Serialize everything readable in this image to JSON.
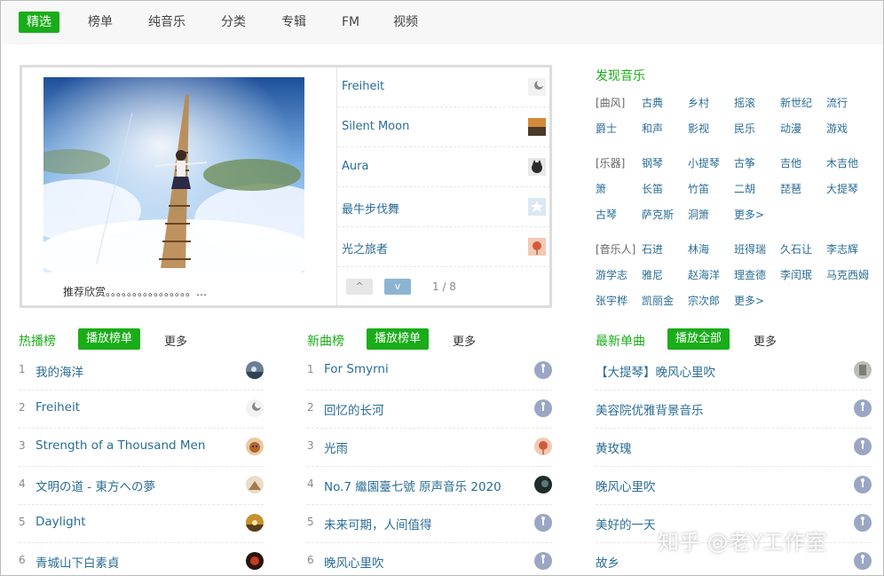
{
  "nav": {
    "tabs": [
      {
        "label": "精选",
        "active": true
      },
      {
        "label": "榜单"
      },
      {
        "label": "纯音乐"
      },
      {
        "label": "分类"
      },
      {
        "label": "专辑"
      },
      {
        "label": "FM"
      },
      {
        "label": "视频"
      }
    ]
  },
  "featured": {
    "caption": "推荐欣赏。。。。。。。。。。。。。。。。…",
    "items": [
      {
        "title": "Freiheit",
        "icon": "moon-thumb"
      },
      {
        "title": "Silent Moon",
        "icon": "sunset-thumb"
      },
      {
        "title": "Aura",
        "icon": "cat-thumb"
      },
      {
        "title": "最牛步伐舞",
        "icon": "star-thumb"
      },
      {
        "title": "光之旅者",
        "icon": "balloon-thumb"
      }
    ],
    "pager": {
      "up": "^",
      "down": "v",
      "info": "1 / 8"
    }
  },
  "discover": {
    "title": "发现音乐",
    "groups": [
      {
        "rows": [
          [
            "[曲风]",
            "古典",
            "乡村",
            "摇滚",
            "新世纪",
            "流行"
          ],
          [
            "爵士",
            "和声",
            "影视",
            "民乐",
            "动漫",
            "游戏"
          ]
        ]
      },
      {
        "rows": [
          [
            "[乐器]",
            "钢琴",
            "小提琴",
            "古筝",
            "吉他",
            "木吉他"
          ],
          [
            "箫",
            "长笛",
            "竹笛",
            "二胡",
            "琵琶",
            "大提琴"
          ],
          [
            "古琴",
            "萨克斯",
            "洞箫",
            "更多>"
          ]
        ]
      },
      {
        "rows": [
          [
            "[音乐人]",
            "石进",
            "林海",
            "班得瑞",
            "久石让",
            "李志辉"
          ],
          [
            "游学志",
            "雅尼",
            "赵海洋",
            "理查德",
            "李闰珉",
            "马克西姆"
          ],
          [
            "张宇桦",
            "凯丽金",
            "宗次郎",
            "更多>"
          ]
        ]
      }
    ]
  },
  "sections": [
    {
      "title": "热播榜",
      "button": "播放榜单",
      "more": "更多",
      "items": [
        {
          "num": "1",
          "title": "我的海洋",
          "icon": "ocean-thumb"
        },
        {
          "num": "2",
          "title": "Freiheit",
          "icon": "moon-thumb"
        },
        {
          "num": "3",
          "title": "Strength of a Thousand Men",
          "icon": "dog-thumb"
        },
        {
          "num": "4",
          "title": "文明の道 - 東方への夢",
          "icon": "desert-thumb"
        },
        {
          "num": "5",
          "title": "Daylight",
          "icon": "sun-thumb"
        },
        {
          "num": "6",
          "title": "青城山下白素貞",
          "icon": "red-thumb"
        }
      ]
    },
    {
      "title": "新曲榜",
      "button": "播放榜单",
      "more": "更多",
      "items": [
        {
          "num": "1",
          "title": "For Smyrni",
          "icon": "default-thumb"
        },
        {
          "num": "2",
          "title": "回忆的长河",
          "icon": "default-thumb"
        },
        {
          "num": "3",
          "title": "光雨",
          "icon": "balloon-thumb"
        },
        {
          "num": "4",
          "title": "No.7 繼園臺七號 原声音乐 2020",
          "icon": "dark-thumb"
        },
        {
          "num": "5",
          "title": "未来可期，人间值得",
          "icon": "default-thumb"
        },
        {
          "num": "6",
          "title": "晚风心里吹",
          "icon": "default-thumb"
        }
      ]
    },
    {
      "title": "最新单曲",
      "button": "播放全部",
      "more": "更多",
      "items": [
        {
          "title": "【大提琴】晚风心里吹",
          "icon": "gray-thumb"
        },
        {
          "title": "美容院优雅背景音乐",
          "icon": "default-thumb"
        },
        {
          "title": "黄玫瑰",
          "icon": "default-thumb"
        },
        {
          "title": "晚风心里吹",
          "icon": "default-thumb"
        },
        {
          "title": "美好的一天",
          "icon": "default-thumb"
        },
        {
          "title": "故乡",
          "icon": "default-thumb"
        }
      ]
    }
  ],
  "watermark": "知乎 @老Y工作室",
  "colors": {
    "accent": "#1aad19",
    "link": "#2a6d95"
  }
}
